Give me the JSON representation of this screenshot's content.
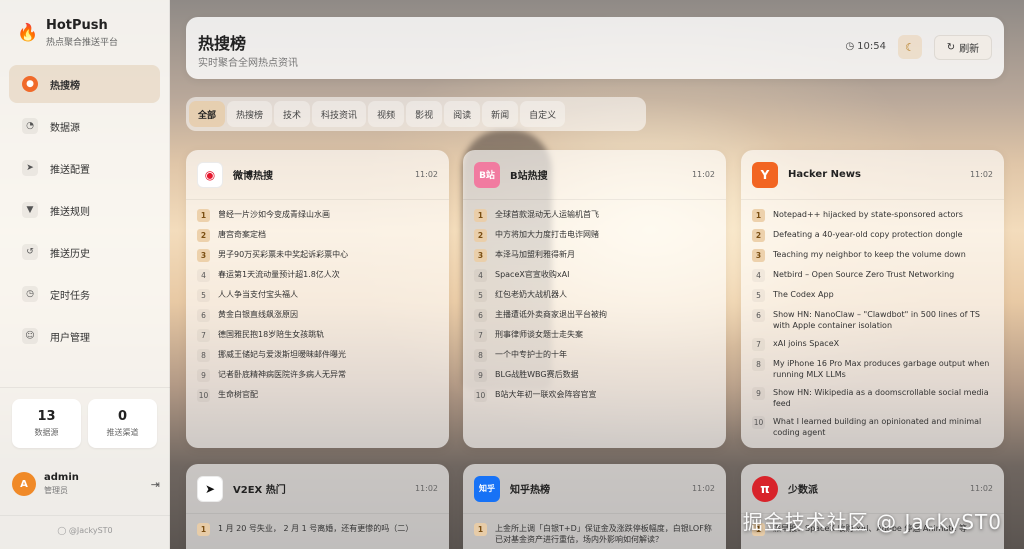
{
  "brand": {
    "name": "HotPush",
    "subtitle": "热点聚合推送平台"
  },
  "nav": [
    {
      "label": "热搜榜",
      "icon": "fire-icon",
      "active": true
    },
    {
      "label": "数据源",
      "icon": "rss-icon"
    },
    {
      "label": "推送配置",
      "icon": "send-icon"
    },
    {
      "label": "推送规则",
      "icon": "filter-icon"
    },
    {
      "label": "推送历史",
      "icon": "history-icon"
    },
    {
      "label": "定时任务",
      "icon": "clock-icon"
    },
    {
      "label": "用户管理",
      "icon": "users-icon"
    }
  ],
  "stats": [
    {
      "value": "13",
      "label": "数据源"
    },
    {
      "value": "0",
      "label": "推送渠道"
    }
  ],
  "user": {
    "initial": "A",
    "name": "admin",
    "role": "管理员"
  },
  "footer": "@JackyST0",
  "header": {
    "title": "热搜榜",
    "subtitle": "实时聚合全网热点资讯",
    "time": "10:54",
    "refresh_label": "刷新"
  },
  "tabs": [
    "全部",
    "热搜榜",
    "技术",
    "科技资讯",
    "视频",
    "影视",
    "阅读",
    "新闻",
    "自定义"
  ],
  "cards": [
    {
      "title": "微博热搜",
      "time": "11:02",
      "icon_color": "#ffffff",
      "icon_text": "微",
      "items": [
        "曾经一片沙如今变成青绿山水画",
        "唐宫奇案定档",
        "男子90万买彩票未中奖起诉彩票中心",
        "春运第1天流动量预计超1.8亿人次",
        "人人争当支付宝头福人",
        "黄金白银直线飙涨原因",
        "德国雅民抱18岁陪生女孩跳轨",
        "挪威王储妃与爱泼斯坦暧昧邮件曝光",
        "记者卧底精神病医院许多病人无异常",
        "生命树官配"
      ]
    },
    {
      "title": "B站热搜",
      "time": "11:02",
      "icon_color": "#f17ba0",
      "icon_text": "B",
      "items": [
        "全球首款混动无人运输机首飞",
        "中方将加大力度打击电诈网赌",
        "本泽马加盟利雅得新月",
        "SpaceX官宣收购xAI",
        "红包老奶大战机器人",
        "主播遭诋外卖商家退出平台被拘",
        "刑事律师谈女题士走失案",
        "一个中专护士的十年",
        "BLG战胜WBG赛后数据",
        "B站大年初一联欢会阵容官宣"
      ]
    },
    {
      "title": "Hacker News",
      "time": "11:02",
      "icon_color": "#f26522",
      "icon_text": "Y",
      "items": [
        "Notepad++ hijacked by state-sponsored actors",
        "Defeating a 40-year-old copy protection dongle",
        "Teaching my neighbor to keep the volume down",
        "Netbird – Open Source Zero Trust Networking",
        "The Codex App",
        "Show HN: NanoClaw – \"Clawdbot\" in 500 lines of TS with Apple container isolation",
        "xAI joins SpaceX",
        "My iPhone 16 Pro Max produces garbage output when running MLX LLMs",
        "Show HN: Wikipedia as a doomscrollable social media feed",
        "What I learned building an opinionated and minimal coding agent"
      ]
    },
    {
      "title": "V2EX 热门",
      "time": "11:02",
      "icon_color": "#ffffff",
      "icon_text": "V",
      "items": [
        "1 月 20 号失业， 2 月 1 号离婚，还有更惨的吗（二）"
      ]
    },
    {
      "title": "知乎热榜",
      "time": "11:02",
      "icon_color": "#1772f6",
      "icon_text": "知乎",
      "items": [
        "上金所上调「白银T+D」保证金及涨跌停板幅度，白银LOF称已对基金资产进行重估，场内外影响如何解读？"
      ]
    },
    {
      "title": "少数派",
      "time": "11:02",
      "icon_color": "#d8232a",
      "icon_text": "π",
      "items": [
        "派早报：SpaceX 收购 xAI、Adobe 停运 Animate 等"
      ]
    }
  ],
  "watermark": "掘金技术社区 @ JackyST0"
}
